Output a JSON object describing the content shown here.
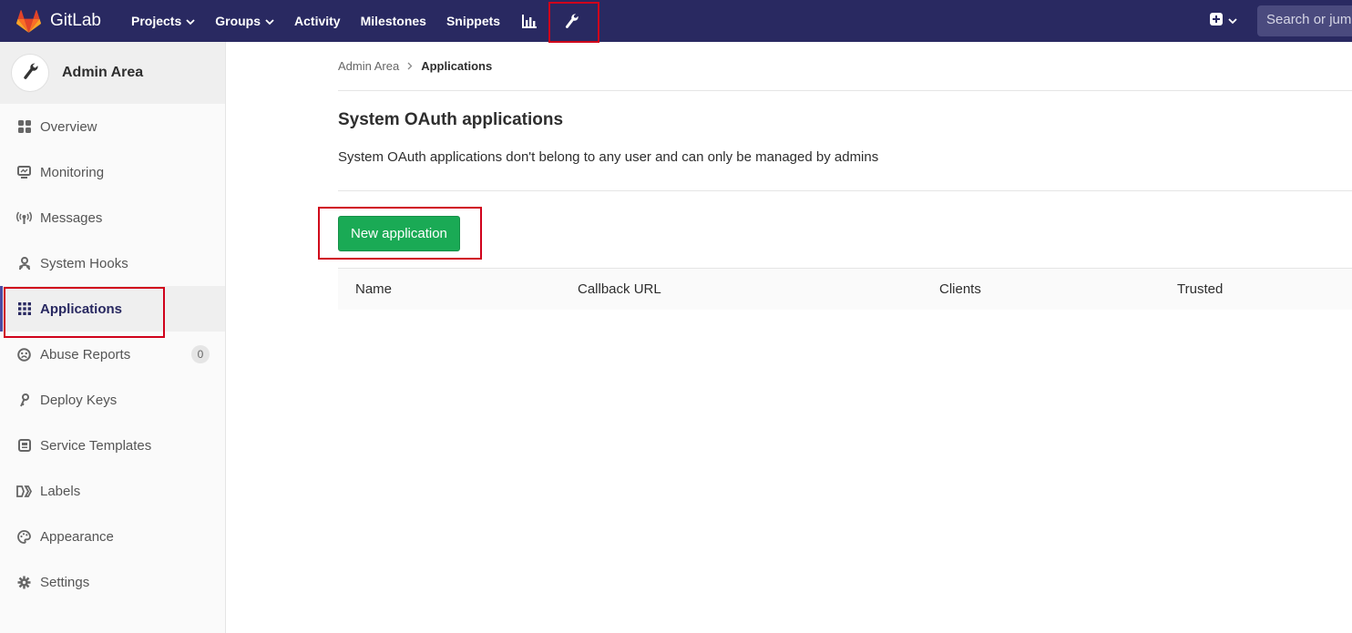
{
  "navbar": {
    "brand": "GitLab",
    "items": [
      {
        "label": "Projects",
        "dropdown": true
      },
      {
        "label": "Groups",
        "dropdown": true
      },
      {
        "label": "Activity",
        "dropdown": false
      },
      {
        "label": "Milestones",
        "dropdown": false
      },
      {
        "label": "Snippets",
        "dropdown": false
      }
    ],
    "icons": [
      "chart-icon",
      "wrench-icon"
    ],
    "search_placeholder": "Search or jum"
  },
  "sidebar": {
    "title": "Admin Area",
    "items": [
      {
        "label": "Overview",
        "icon": "overview-icon"
      },
      {
        "label": "Monitoring",
        "icon": "monitor-icon"
      },
      {
        "label": "Messages",
        "icon": "broadcast-icon"
      },
      {
        "label": "System Hooks",
        "icon": "hook-icon"
      },
      {
        "label": "Applications",
        "icon": "apps-grid-icon",
        "active": true
      },
      {
        "label": "Abuse Reports",
        "icon": "abuse-icon",
        "badge": "0"
      },
      {
        "label": "Deploy Keys",
        "icon": "key-icon"
      },
      {
        "label": "Service Templates",
        "icon": "template-icon"
      },
      {
        "label": "Labels",
        "icon": "labels-icon"
      },
      {
        "label": "Appearance",
        "icon": "appearance-icon"
      },
      {
        "label": "Settings",
        "icon": "gear-icon"
      }
    ]
  },
  "breadcrumb": {
    "parent": "Admin Area",
    "current": "Applications"
  },
  "main": {
    "title": "System OAuth applications",
    "description": "System OAuth applications don't belong to any user and can only be managed by admins",
    "new_button": "New application",
    "table_headers": [
      "Name",
      "Callback URL",
      "Clients",
      "Trusted"
    ]
  },
  "colors": {
    "navbar": "#292961",
    "primary_button": "#1aaa55",
    "highlight": "#d0021b"
  }
}
